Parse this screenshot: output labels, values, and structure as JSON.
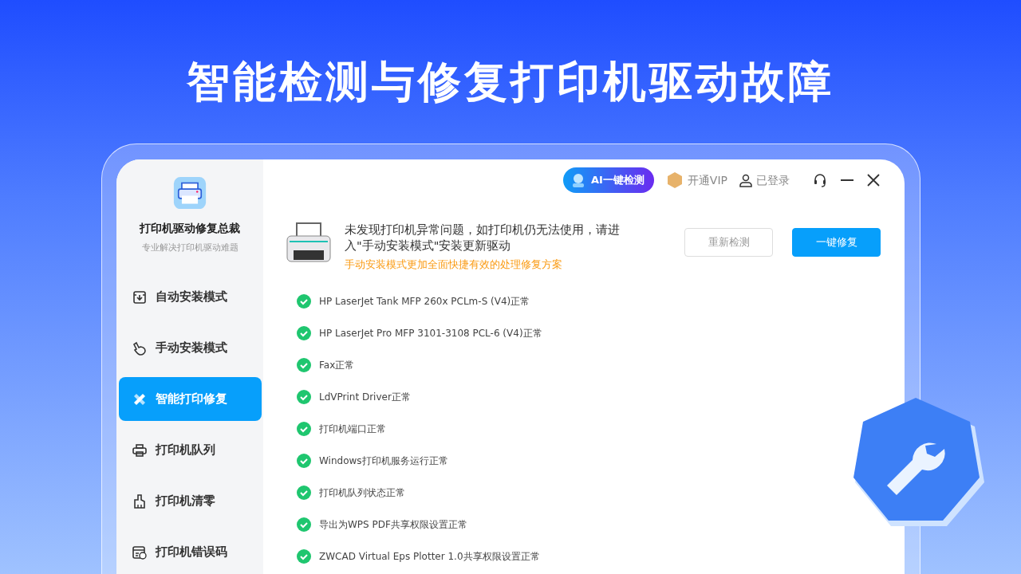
{
  "headline": "智能检测与修复打印机驱动故障",
  "sidebar": {
    "app_name": "打印机驱动修复总裁",
    "tagline": "专业解决打印机驱动难题",
    "items": [
      {
        "label": "自动安装模式",
        "selected": false
      },
      {
        "label": "手动安装模式",
        "selected": false
      },
      {
        "label": "智能打印修复",
        "selected": true
      },
      {
        "label": "打印机队列",
        "selected": false
      },
      {
        "label": "打印机清零",
        "selected": false
      },
      {
        "label": "打印机错误码",
        "selected": false
      }
    ]
  },
  "topbar": {
    "ai_button": "AI一键检测",
    "vip": "开通VIP",
    "account": "已登录"
  },
  "notice": {
    "message": "未发现打印机异常问题，如打印机仍无法使用，请进入\"手动安装模式\"安装更新驱动",
    "hint": "手动安装模式更加全面快捷有效的处理修复方案",
    "buttons": [
      {
        "label": "重新检测",
        "kind": "secondary"
      },
      {
        "label": "一键修复",
        "kind": "primary"
      }
    ]
  },
  "checks": [
    {
      "text": "HP LaserJet Tank MFP 260x PCLm-S (V4)正常"
    },
    {
      "text": "HP LaserJet Pro MFP 3101-3108 PCL-6 (V4)正常"
    },
    {
      "text": "Fax正常"
    },
    {
      "text": "LdVPrint Driver正常"
    },
    {
      "text": "打印机端口正常"
    },
    {
      "text": "Windows打印机服务运行正常"
    },
    {
      "text": "打印机队列状态正常"
    },
    {
      "text": "导出为WPS PDF共享权限设置正常"
    },
    {
      "text": "ZWCAD Virtual Eps Plotter 1.0共享权限设置正常"
    }
  ]
}
